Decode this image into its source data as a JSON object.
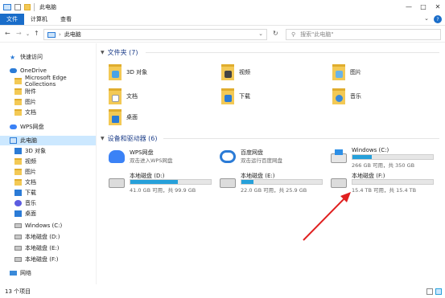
{
  "window": {
    "title": "此电脑"
  },
  "ribbon": {
    "tabs": [
      "文件",
      "计算机",
      "查看"
    ]
  },
  "address": {
    "path": "此电脑",
    "search_placeholder": "搜索\"此电脑\""
  },
  "sidebar": {
    "items": [
      {
        "label": "快速访问",
        "icon": "star-icon"
      },
      {
        "label": "OneDrive",
        "icon": "cloud-icon"
      },
      {
        "label": "Microsoft Edge Collections",
        "icon": "folder-icon"
      },
      {
        "label": "附件",
        "icon": "folder-icon"
      },
      {
        "label": "图片",
        "icon": "folder-icon"
      },
      {
        "label": "文档",
        "icon": "folder-icon"
      },
      {
        "label": "WPS网盘",
        "icon": "wps-cloud-icon"
      },
      {
        "label": "此电脑",
        "icon": "computer-icon"
      },
      {
        "label": "3D 对象",
        "icon": "cube-icon"
      },
      {
        "label": "视频",
        "icon": "video-icon"
      },
      {
        "label": "图片",
        "icon": "picture-icon"
      },
      {
        "label": "文档",
        "icon": "document-icon"
      },
      {
        "label": "下载",
        "icon": "download-icon"
      },
      {
        "label": "音乐",
        "icon": "music-icon"
      },
      {
        "label": "桌面",
        "icon": "desktop-icon"
      },
      {
        "label": "Windows (C:)",
        "icon": "windows-drive-icon"
      },
      {
        "label": "本地磁盘 (D:)",
        "icon": "drive-icon"
      },
      {
        "label": "本地磁盘 (E:)",
        "icon": "drive-icon"
      },
      {
        "label": "本地磁盘 (F:)",
        "icon": "drive-icon"
      },
      {
        "label": "网络",
        "icon": "network-icon"
      }
    ]
  },
  "folders": {
    "header": "文件夹 (7)",
    "items": [
      {
        "label": "3D 对象"
      },
      {
        "label": "视频"
      },
      {
        "label": "图片"
      },
      {
        "label": "文档"
      },
      {
        "label": "下载"
      },
      {
        "label": "音乐"
      },
      {
        "label": "桌面"
      }
    ]
  },
  "devices": {
    "header": "设备和驱动器 (6)",
    "items": [
      {
        "name": "WPS网盘",
        "info": "双击进入WPS网盘"
      },
      {
        "name": "百度网盘",
        "info": "双击运行百度网盘"
      },
      {
        "name": "Windows (C:)",
        "info": "266 GB 可用，共 350 GB",
        "used_fraction": 0.24
      },
      {
        "name": "本地磁盘 (D:)",
        "info": "41.0 GB 可用，共 99.9 GB",
        "used_fraction": 0.59
      },
      {
        "name": "本地磁盘 (E:)",
        "info": "22.0 GB 可用，共 25.9 GB",
        "used_fraction": 0.15
      },
      {
        "name": "本地磁盘 (F:)",
        "info": "15.4 TB 可用，共 15.4 TB",
        "used_fraction": 0.0
      }
    ]
  },
  "status": {
    "count": "13 个项目"
  },
  "colors": {
    "accent": "#1a6dc9",
    "bar_fill": "#26a0da",
    "arrow": "#e02020"
  }
}
